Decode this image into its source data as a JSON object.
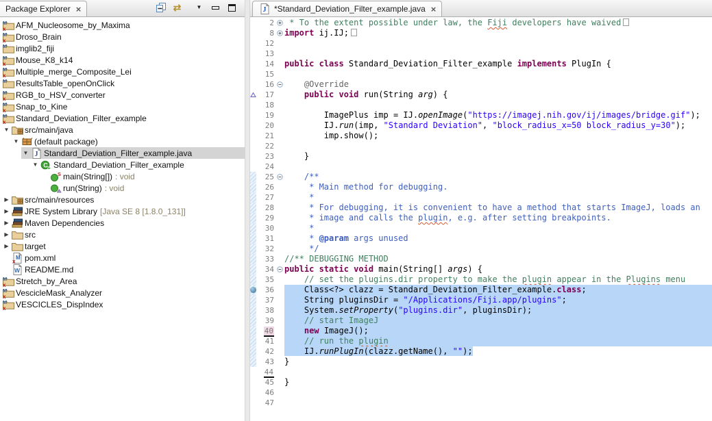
{
  "icons": {
    "tree_expanded": "▼",
    "tree_collapsed": "▶",
    "close": "×",
    "link_with_editor": "⇄",
    "view_menu": "▼"
  },
  "package_explorer": {
    "tab_label": "Package Explorer",
    "toolbar": [
      "collapse-all",
      "link-with-editor",
      "view-menu",
      "minimize",
      "maximize"
    ],
    "tree": [
      {
        "label": "AFM_Nucleosome_by_Maxima",
        "level": 0,
        "arrow": "none",
        "icon": "maven-project-error"
      },
      {
        "label": "Droso_Brain",
        "level": 0,
        "arrow": "none",
        "icon": "maven-project-error"
      },
      {
        "label": "imglib2_fiji",
        "level": 0,
        "arrow": "none",
        "icon": "maven-project"
      },
      {
        "label": "Mouse_K8_k14",
        "level": 0,
        "arrow": "none",
        "icon": "maven-project-error"
      },
      {
        "label": "Multiple_merge_Composite_Lei",
        "level": 0,
        "arrow": "none",
        "icon": "maven-project-error"
      },
      {
        "label": "ResultsTable_openOnClick",
        "level": 0,
        "arrow": "none",
        "icon": "maven-project"
      },
      {
        "label": "RGB_to_HSV_converter",
        "level": 0,
        "arrow": "none",
        "icon": "maven-project-error"
      },
      {
        "label": "Snap_to_Kine",
        "level": 0,
        "arrow": "none",
        "icon": "maven-project-error"
      },
      {
        "label": "Standard_Deviation_Filter_example",
        "level": 0,
        "arrow": "none",
        "icon": "maven-project-error"
      },
      {
        "label": "src/main/java",
        "level": 1,
        "arrow": "expanded",
        "icon": "source-folder"
      },
      {
        "label": "(default package)",
        "level": 2,
        "arrow": "expanded",
        "icon": "package"
      },
      {
        "label": "Standard_Deviation_Filter_example.java",
        "level": 3,
        "arrow": "expanded",
        "icon": "java-file",
        "selected": true
      },
      {
        "label": "Standard_Deviation_Filter_example",
        "level": 4,
        "arrow": "expanded",
        "icon": "class-runnable"
      },
      {
        "label": "main(String[])",
        "suffix": ": void",
        "level": 5,
        "arrow": "none",
        "icon": "method-static"
      },
      {
        "label": "run(String)",
        "suffix": ": void",
        "level": 5,
        "arrow": "none",
        "icon": "method-override"
      },
      {
        "label": "src/main/resources",
        "level": 1,
        "arrow": "collapsed",
        "icon": "source-folder"
      },
      {
        "label": "JRE System Library",
        "suffix": "[Java SE 8 [1.8.0_131]]",
        "level": 1,
        "arrow": "collapsed",
        "icon": "library"
      },
      {
        "label": "Maven Dependencies",
        "level": 1,
        "arrow": "collapsed",
        "icon": "library"
      },
      {
        "label": "src",
        "level": 1,
        "arrow": "collapsed",
        "icon": "folder"
      },
      {
        "label": "target",
        "level": 1,
        "arrow": "collapsed",
        "icon": "folder"
      },
      {
        "label": "pom.xml",
        "level": 1,
        "arrow": "none",
        "icon": "pom-file"
      },
      {
        "label": "README.md",
        "level": 1,
        "arrow": "none",
        "icon": "readme-file"
      },
      {
        "label": "Stretch_by_Area",
        "level": 0,
        "arrow": "none",
        "icon": "maven-project-error"
      },
      {
        "label": "VescicleMask_Analyzer",
        "level": 0,
        "arrow": "none",
        "icon": "maven-project-error"
      },
      {
        "label": "VESCICLES_DispIndex",
        "level": 0,
        "arrow": "none",
        "icon": "maven-project-error"
      }
    ]
  },
  "editor": {
    "tab_label": "*Standard_Deviation_Filter_example.java",
    "tab_icon": "java-file",
    "lines": [
      {
        "n": 2,
        "fold": "plus",
        "seg": [
          [
            " * To the extent possible under law, the ",
            "c"
          ],
          [
            "Fiji",
            "cq"
          ],
          [
            " developers have waived",
            "c"
          ],
          [
            "",
            "box"
          ]
        ]
      },
      {
        "n": 8,
        "fold": "plus",
        "seg": [
          [
            "import",
            "k"
          ],
          [
            " ij.IJ;",
            "p"
          ],
          [
            "",
            "box"
          ]
        ]
      },
      {
        "n": 12
      },
      {
        "n": 13
      },
      {
        "n": 14,
        "seg": [
          [
            "public class",
            "k"
          ],
          [
            " Standard_Deviation_Filter_example ",
            "p"
          ],
          [
            "implements",
            "k"
          ],
          [
            " PlugIn {",
            "p"
          ]
        ]
      },
      {
        "n": 15
      },
      {
        "n": 16,
        "fold": "minus",
        "seg": [
          [
            "    ",
            "p"
          ],
          [
            "@Override",
            "a"
          ]
        ]
      },
      {
        "n": 17,
        "mark": "override",
        "seg": [
          [
            "    ",
            "p"
          ],
          [
            "public void",
            "k"
          ],
          [
            " run(String ",
            "p"
          ],
          [
            "arg",
            "pi"
          ],
          [
            ") {",
            "p"
          ]
        ]
      },
      {
        "n": 18
      },
      {
        "n": 19,
        "seg": [
          [
            "        ImagePlus imp = IJ.",
            "p"
          ],
          [
            "openImage",
            "m"
          ],
          [
            "(",
            "p"
          ],
          [
            "\"https://imagej.nih.gov/ij/images/bridge.gif\"",
            "s"
          ],
          [
            ");",
            "p"
          ]
        ]
      },
      {
        "n": 20,
        "seg": [
          [
            "        IJ.",
            "p"
          ],
          [
            "run",
            "m"
          ],
          [
            "(imp, ",
            "p"
          ],
          [
            "\"Standard Deviation\"",
            "s"
          ],
          [
            ", ",
            "p"
          ],
          [
            "\"block_radius_x=50 block_radius_y=30\"",
            "s"
          ],
          [
            ");",
            "p"
          ]
        ]
      },
      {
        "n": 21,
        "seg": [
          [
            "        imp.show();",
            "p"
          ]
        ]
      },
      {
        "n": 22
      },
      {
        "n": 23,
        "seg": [
          [
            "    }",
            "p"
          ]
        ]
      },
      {
        "n": 24
      },
      {
        "n": 25,
        "fold": "minus",
        "range": true,
        "seg": [
          [
            "    /**",
            "j"
          ]
        ]
      },
      {
        "n": 26,
        "range": true,
        "seg": [
          [
            "     * Main method for debugging.",
            "j"
          ]
        ]
      },
      {
        "n": 27,
        "range": true,
        "seg": [
          [
            "     *",
            "j"
          ]
        ]
      },
      {
        "n": 28,
        "range": true,
        "seg": [
          [
            "     * For debugging, it is convenient to have a method that starts ImageJ, loads an",
            "j"
          ]
        ]
      },
      {
        "n": 29,
        "range": true,
        "seg": [
          [
            "     * image and calls the ",
            "j"
          ],
          [
            "plugin",
            "jq"
          ],
          [
            ", e.g. after setting breakpoints.",
            "j"
          ]
        ]
      },
      {
        "n": 30,
        "range": true,
        "seg": [
          [
            "     *",
            "j"
          ]
        ]
      },
      {
        "n": 31,
        "range": true,
        "seg": [
          [
            "     * ",
            "j"
          ],
          [
            "@param",
            "jt"
          ],
          [
            " args unused",
            "j"
          ]
        ]
      },
      {
        "n": 32,
        "range": true,
        "seg": [
          [
            "     */",
            "j"
          ]
        ]
      },
      {
        "n": 33,
        "range": true,
        "seg": [
          [
            "//** DEBUGGING METHOD",
            "c"
          ]
        ]
      },
      {
        "n": 34,
        "fold": "minus",
        "range": true,
        "seg": [
          [
            "public static void",
            "k"
          ],
          [
            " main(String[] ",
            "p"
          ],
          [
            "args",
            "pi"
          ],
          [
            ") {",
            "p"
          ]
        ]
      },
      {
        "n": 35,
        "range": true,
        "seg": [
          [
            "    ",
            "p"
          ],
          [
            "// set the plugins.dir property to make the ",
            "c"
          ],
          [
            "plugin",
            "cq"
          ],
          [
            " appear in the ",
            "c"
          ],
          [
            "Plugins",
            "cq"
          ],
          [
            " menu",
            "c"
          ]
        ]
      },
      {
        "n": 36,
        "range": true,
        "mark": "breakpoint",
        "sel": "full",
        "seg": [
          [
            "    Class<?> clazz = Standard_Deviation_Filter_example.",
            "p"
          ],
          [
            "class",
            "k"
          ],
          [
            ";",
            "p"
          ]
        ]
      },
      {
        "n": 37,
        "range": true,
        "sel": "full",
        "seg": [
          [
            "    String pluginsDir = ",
            "p"
          ],
          [
            "\"/Applications/Fiji.app/plugins\"",
            "s"
          ],
          [
            ";",
            "p"
          ]
        ]
      },
      {
        "n": 38,
        "range": true,
        "sel": "full",
        "seg": [
          [
            "    System.",
            "p"
          ],
          [
            "setProperty",
            "m"
          ],
          [
            "(",
            "p"
          ],
          [
            "\"plugins.dir\"",
            "s"
          ],
          [
            ", pluginsDir);",
            "p"
          ]
        ]
      },
      {
        "n": 39,
        "range": true,
        "sel": "full",
        "seg": [
          [
            "    ",
            "p"
          ],
          [
            "// start ImageJ",
            "c"
          ]
        ]
      },
      {
        "n": 40,
        "range": true,
        "sel": "full",
        "numhl": true,
        "seg": [
          [
            "    ",
            "p"
          ],
          [
            "new",
            "k"
          ],
          [
            " ImageJ();",
            "p"
          ]
        ]
      },
      {
        "n": 41,
        "range": true,
        "sel": "full",
        "seg": [
          [
            "    ",
            "p"
          ],
          [
            "// run the ",
            "c"
          ],
          [
            "plugin",
            "cq"
          ]
        ]
      },
      {
        "n": 42,
        "range": true,
        "sel": "text",
        "seg": [
          [
            "    IJ.",
            "p"
          ],
          [
            "runPlugIn",
            "m"
          ],
          [
            "(clazz.getName(), ",
            "p"
          ],
          [
            "\"\"",
            "s"
          ],
          [
            ");",
            "p"
          ]
        ]
      },
      {
        "n": 43,
        "range": true,
        "seg": [
          [
            "}",
            "p"
          ]
        ]
      },
      {
        "n": 44,
        "numline": true
      },
      {
        "n": 45,
        "seg": [
          [
            "}",
            "p"
          ]
        ]
      },
      {
        "n": 46
      },
      {
        "n": 47
      }
    ]
  }
}
